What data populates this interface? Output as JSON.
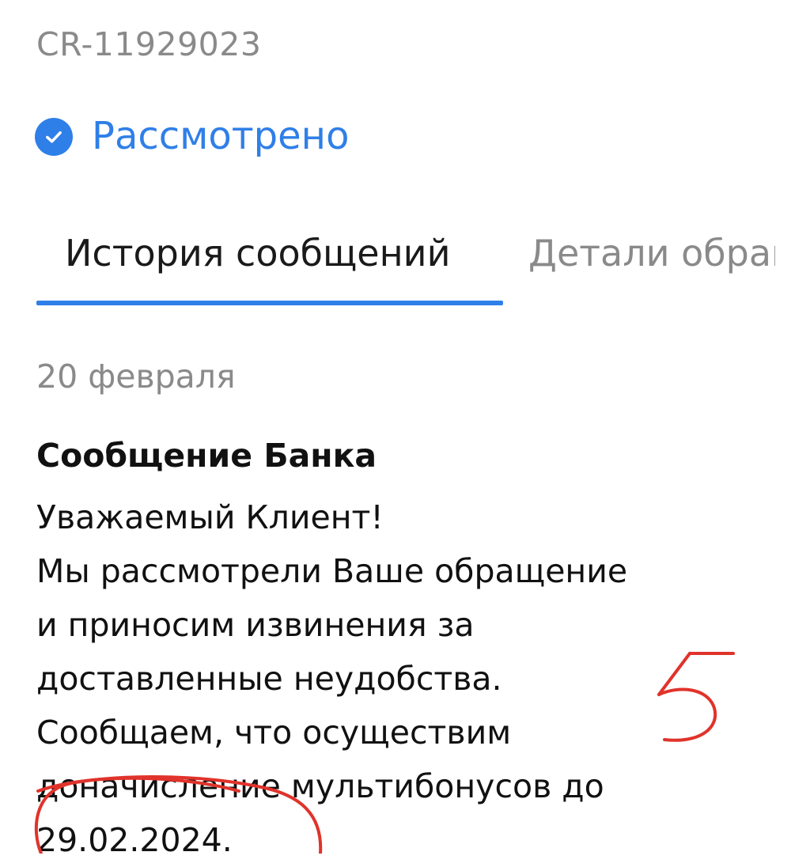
{
  "case": {
    "id": "CR-11929023"
  },
  "status": {
    "icon": "checkmark-circle-icon",
    "label": "Рассмотрено",
    "color": "#2f7fe8"
  },
  "tabs": [
    {
      "label": "История сообщений",
      "active": true
    },
    {
      "label": "Детали обращения",
      "active": false
    }
  ],
  "message": {
    "date": "20 февраля",
    "title": "Сообщение Банка",
    "lines": [
      "Уважаемый Клиент!",
      "Мы рассмотрели Ваше обращение",
      "и приносим извинения за",
      "доставленные неудобства.",
      "Сообщаем, что осуществим",
      "доначисление мультибонусов до",
      "29.02.2024."
    ]
  },
  "annotation": {
    "text": "5",
    "color": "#e0332b"
  }
}
